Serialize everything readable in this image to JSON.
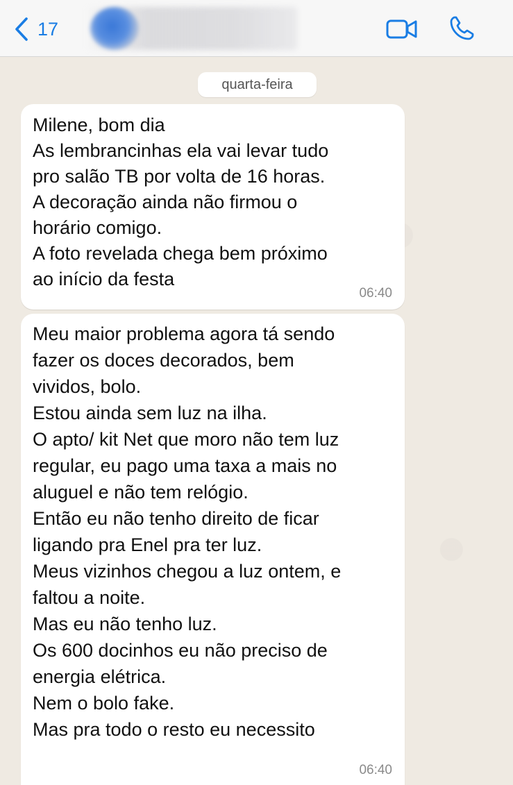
{
  "header": {
    "back_count": "17",
    "back_icon": "chevron-left-icon",
    "video_icon": "video-camera-icon",
    "phone_icon": "phone-icon",
    "accent_color": "#1a7de4"
  },
  "date_separator": "quarta-feira",
  "messages": [
    {
      "lines": [
        "Milene, bom dia",
        "As lembrancinhas ela vai levar tudo",
        "pro salão TB por volta de 16 horas.",
        "A decoração ainda não firmou o",
        "horário comigo.",
        "A foto revelada chega bem próximo",
        "ao início da festa"
      ],
      "time": "06:40"
    },
    {
      "lines": [
        "Meu maior problema agora tá sendo",
        "fazer os doces decorados, bem",
        "vividos, bolo.",
        "Estou ainda sem luz na ilha.",
        "O apto/ kit Net que moro não tem luz",
        "regular, eu pago uma taxa a mais no",
        "aluguel e não tem relógio.",
        "Então eu não tenho direito de ficar",
        "ligando pra Enel pra ter luz.",
        "Meus vizinhos chegou a luz ontem, e",
        "faltou a noite.",
        "Mas eu não tenho luz.",
        "Os 600 docinhos eu não preciso de",
        "energia elétrica.",
        "Nem o bolo fake.",
        "Mas pra todo o resto eu necessito"
      ],
      "time": "06:40"
    }
  ]
}
